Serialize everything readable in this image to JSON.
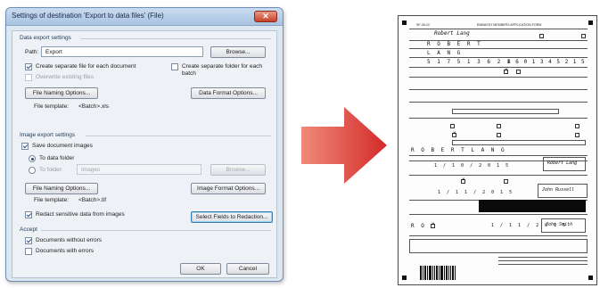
{
  "dialog": {
    "title": "Settings of destination 'Export to data files' (File)",
    "close_glyph": "✕",
    "data_export": {
      "group_label": "Data export settings",
      "path_label": "Path:",
      "path_value": "Export",
      "browse_label": "Browse...",
      "separate_file_label": "Create separate file for each document",
      "separate_folder_label": "Create separate folder for each batch",
      "overwrite_label": "Overwrite existing files",
      "file_naming_label": "File Naming Options...",
      "data_format_label": "Data Format Options...",
      "file_template_label": "File template:",
      "file_template_value": "<Batch>.xls"
    },
    "image_export": {
      "group_label": "Image export settings",
      "save_images_label": "Save document images",
      "to_data_folder_label": "To data folder",
      "to_folder_label": "To folder:",
      "folder_value": "Images",
      "browse_label": "Browse...",
      "file_naming_label": "File Naming Options...",
      "image_format_label": "Image Format Options...",
      "file_template_label": "File template:",
      "file_template_value": "<Batch>.tif",
      "redact_label": "Redact sensitive data from images",
      "select_fields_label": "Select Fields to Redaction..."
    },
    "accept": {
      "group_label": "Accept",
      "without_errors_label": "Documents without errors",
      "with_errors_label": "Documents with errors"
    },
    "ok_label": "OK",
    "cancel_label": "Cancel"
  },
  "arrow": {
    "color_start": "#f08a7a",
    "color_end": "#d42a2a"
  },
  "document": {
    "header_left": "SF-39-12",
    "header_center": "EMBASSY MEMBERS APPLICATION FORM",
    "name_handwritten": "Robert Lang",
    "first_name_handwritten": "R O B E R T",
    "last_name_handwritten": "L A N G",
    "id_number_handwritten": "5 1 7 5 1 3 6 2 1",
    "phone_handwritten": "8 6 0 1 3 4 5 2 1 5",
    "full_name_handwritten": "R O B E R T   L A N G",
    "date_one": "1 / 1 0 / 2 0 1 5",
    "date_two": "1 / 1 1 / 2 0 1 5",
    "date_three": "1 / 1 1 / 2 0 1 5",
    "code_handwritten": "R O",
    "signature_one": "Robert Lang",
    "signature_two": "John Russell",
    "signature_three": "John Smith"
  }
}
